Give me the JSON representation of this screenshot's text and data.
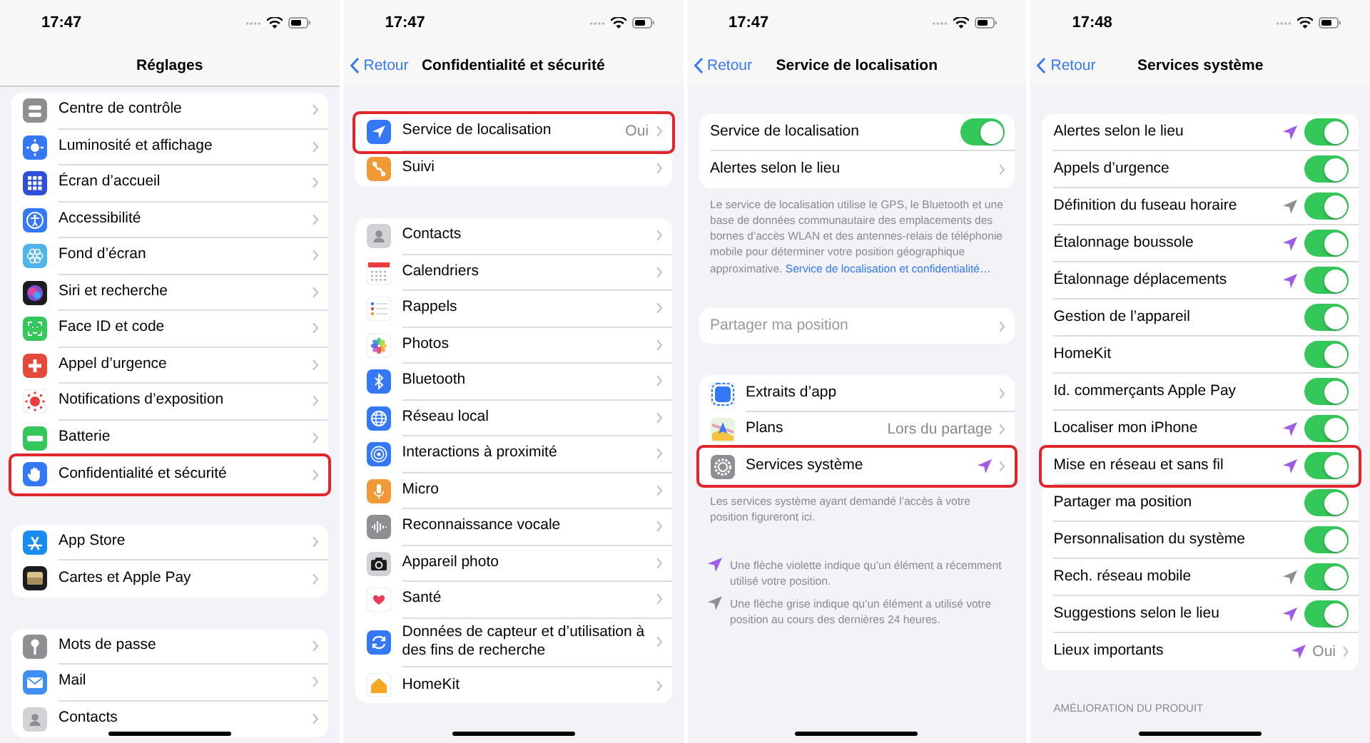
{
  "screens": [
    {
      "time": "17:47",
      "title": "Réglages",
      "scrolled": true,
      "groups": [
        {
          "rows": [
            {
              "kind": "link",
              "label": "Centre de contrôle",
              "highlighted": false
            },
            {
              "kind": "link",
              "label": "Luminosité et affichage",
              "highlighted": false
            },
            {
              "kind": "link",
              "label": "Écran d’accueil",
              "highlighted": false
            },
            {
              "kind": "link",
              "label": "Accessibilité",
              "highlighted": false
            },
            {
              "kind": "link",
              "label": "Fond d’écran",
              "highlighted": false
            },
            {
              "kind": "link",
              "label": "Siri et recherche",
              "highlighted": false
            },
            {
              "kind": "link",
              "label": "Face ID et code",
              "highlighted": false
            },
            {
              "kind": "link",
              "label": "Appel d’urgence",
              "highlighted": false
            },
            {
              "kind": "link",
              "label": "Notifications d’exposition",
              "highlighted": false
            },
            {
              "kind": "link",
              "label": "Batterie",
              "highlighted": false
            },
            {
              "kind": "link",
              "label": "Confidentialité et sécurité",
              "highlighted": true
            }
          ]
        },
        {
          "rows": [
            {
              "kind": "link",
              "label": "App Store",
              "highlighted": false
            },
            {
              "kind": "link",
              "label": "Cartes et Apple Pay",
              "highlighted": false
            }
          ]
        },
        {
          "rows": [
            {
              "kind": "link",
              "label": "Mots de passe",
              "highlighted": false
            },
            {
              "kind": "link",
              "label": "Mail",
              "highlighted": false
            },
            {
              "kind": "link",
              "label": "Contacts",
              "highlighted": false
            }
          ]
        }
      ]
    },
    {
      "time": "17:47",
      "back": "Retour",
      "title": "Confidentialité et sécurité",
      "scrolled": false,
      "groups": [
        {
          "rows": [
            {
              "kind": "link",
              "label": "Service de localisation",
              "value": "Oui",
              "highlighted": true
            },
            {
              "kind": "link",
              "label": "Suivi",
              "highlighted": false
            }
          ]
        },
        {
          "rows": [
            {
              "kind": "link",
              "label": "Contacts",
              "highlighted": false
            },
            {
              "kind": "link",
              "label": "Calendriers",
              "highlighted": false
            },
            {
              "kind": "link",
              "label": "Rappels",
              "highlighted": false
            },
            {
              "kind": "link",
              "label": "Photos",
              "highlighted": false
            },
            {
              "kind": "link",
              "label": "Bluetooth",
              "highlighted": false
            },
            {
              "kind": "link",
              "label": "Réseau local",
              "highlighted": false
            },
            {
              "kind": "link",
              "label": "Interactions à proximité",
              "highlighted": false
            },
            {
              "kind": "link",
              "label": "Micro",
              "highlighted": false
            },
            {
              "kind": "link",
              "label": "Reconnaissance vocale",
              "highlighted": false
            },
            {
              "kind": "link",
              "label": "Appareil photo",
              "highlighted": false
            },
            {
              "kind": "link",
              "label": "Santé",
              "highlighted": false
            },
            {
              "kind": "link",
              "label": "Données de capteur et d’utilisation à des fins de recherche",
              "highlighted": false
            },
            {
              "kind": "link",
              "label": "HomeKit",
              "highlighted": false
            }
          ]
        }
      ]
    },
    {
      "time": "17:47",
      "back": "Retour",
      "title": "Service de localisation",
      "scrolled": false,
      "groups": [
        {
          "rows": [
            {
              "kind": "toggle",
              "label": "Service de localisation",
              "on": true,
              "highlighted": false
            },
            {
              "kind": "link",
              "label": "Alertes selon le lieu",
              "highlighted": false
            }
          ],
          "footer": {
            "text": "Le service de localisation utilise le GPS, le Bluetooth et une base de données communautaire des emplacements des bornes d’accès WLAN et des antennes-relais de téléphonie mobile pour déterminer votre position géographique approximative.",
            "link": "Service de localisation et confidentialité…"
          }
        },
        {
          "rows": [
            {
              "kind": "disabled",
              "label": "Partager ma position",
              "highlighted": false
            }
          ]
        },
        {
          "rows": [
            {
              "kind": "link",
              "label": "Extraits d’app",
              "highlighted": false
            },
            {
              "kind": "link",
              "label": "Plans",
              "value": "Lors du partage",
              "highlighted": false
            },
            {
              "kind": "link",
              "label": "Services système",
              "arrow": {
                "color": "#a05ce8"
              },
              "highlighted": true
            }
          ],
          "footer": {
            "text": "Les services système ayant demandé l’accès à votre position figureront ici."
          },
          "legend": [
            {
              "arrow": {
                "color": "#a05ce8"
              },
              "text": "Une flèche violette indique qu’un élément a récemment utilisé votre position."
            },
            {
              "arrow": {
                "color": "#8e8e93"
              },
              "text": "Une flèche grise indique qu’un élément a utilisé votre position au cours des dernières 24 heures."
            }
          ]
        }
      ]
    },
    {
      "time": "17:48",
      "back": "Retour",
      "title": "Services système",
      "scrolled": false,
      "groups": [
        {
          "rows": [
            {
              "kind": "toggle",
              "label": "Alertes selon le lieu",
              "arrow": {
                "color": "#a05ce8"
              },
              "on": true,
              "highlighted": false
            },
            {
              "kind": "toggle",
              "label": "Appels d’urgence",
              "on": true,
              "highlighted": false
            },
            {
              "kind": "toggle",
              "label": "Définition du fuseau horaire",
              "arrow": {
                "color": "#8e8e93"
              },
              "on": true,
              "highlighted": false
            },
            {
              "kind": "toggle",
              "label": "Étalonnage boussole",
              "arrow": {
                "color": "#a05ce8"
              },
              "on": true,
              "highlighted": false
            },
            {
              "kind": "toggle",
              "label": "Étalonnage déplacements",
              "arrow": {
                "color": "#a05ce8"
              },
              "on": true,
              "highlighted": false
            },
            {
              "kind": "toggle",
              "label": "Gestion de l’appareil",
              "on": true,
              "highlighted": false
            },
            {
              "kind": "toggle",
              "label": "HomeKit",
              "on": true,
              "highlighted": false
            },
            {
              "kind": "toggle",
              "label": "Id. commerçants Apple Pay",
              "on": true,
              "highlighted": false
            },
            {
              "kind": "toggle",
              "label": "Localiser mon iPhone",
              "arrow": {
                "color": "#a05ce8"
              },
              "on": true,
              "highlighted": false
            },
            {
              "kind": "toggle",
              "label": "Mise en réseau et sans fil",
              "arrow": {
                "color": "#a05ce8"
              },
              "on": true,
              "highlighted": true
            },
            {
              "kind": "toggle",
              "label": "Partager ma position",
              "on": true,
              "highlighted": false
            },
            {
              "kind": "toggle",
              "label": "Personnalisation du système",
              "on": true,
              "highlighted": false
            },
            {
              "kind": "toggle",
              "label": "Rech. réseau mobile",
              "arrow": {
                "color": "#8e8e93"
              },
              "on": true,
              "highlighted": false
            },
            {
              "kind": "toggle",
              "label": "Suggestions selon le lieu",
              "arrow": {
                "color": "#a05ce8"
              },
              "on": true,
              "highlighted": false
            },
            {
              "kind": "link",
              "label": "Lieux importants",
              "arrow": {
                "color": "#a05ce8"
              },
              "value": "Oui",
              "highlighted": false
            }
          ]
        },
        {
          "header": "AMÉLIORATION DU PRODUIT"
        }
      ]
    }
  ]
}
